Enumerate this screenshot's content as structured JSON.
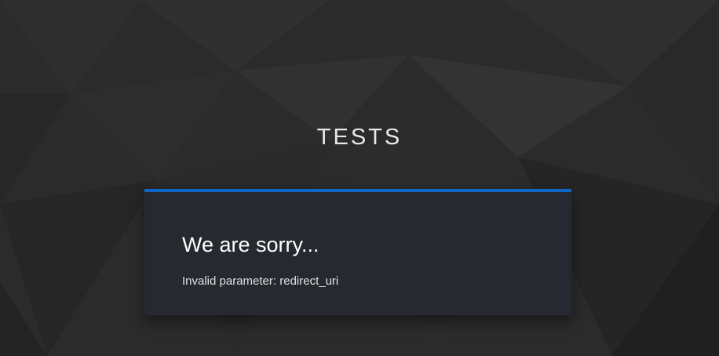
{
  "header": {
    "realm_name": "TESTS"
  },
  "error_card": {
    "heading": "We are sorry...",
    "message": "Invalid parameter: redirect_uri",
    "accent_color": "#0f66c6",
    "card_color": "#26292f"
  },
  "page": {
    "background_color": "#2a2a2a"
  }
}
